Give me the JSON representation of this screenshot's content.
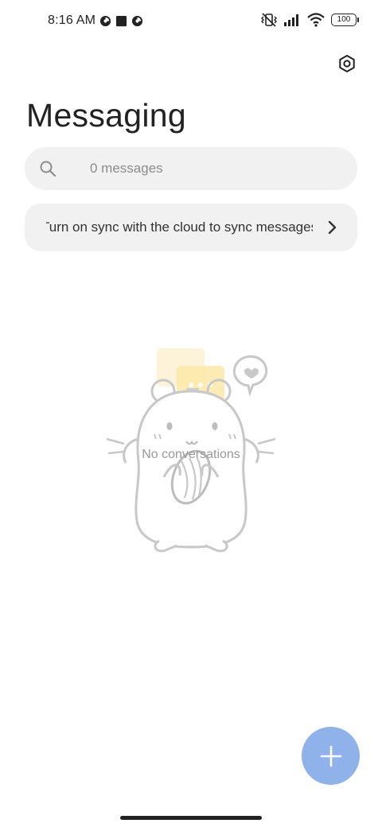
{
  "status_bar": {
    "time": "8:16 AM",
    "battery": "100",
    "left_icons": [
      "data-saver-icon",
      "square-notification-icon",
      "data-saver-icon"
    ],
    "right_icons": [
      "vibrate-off-icon",
      "signal-icon",
      "wifi-icon",
      "battery-icon"
    ]
  },
  "header": {
    "title": "Messaging",
    "settings_icon": "settings-hexagon-icon"
  },
  "search": {
    "placeholder": "0 messages",
    "icon": "search-icon"
  },
  "sync_banner": {
    "text": "Turn on sync with the cloud to sync messages",
    "icon": "chevron-right-icon"
  },
  "empty_state": {
    "message": "No conversations",
    "illustration": "hamster-illustration"
  },
  "fab": {
    "icon": "plus-icon",
    "color": "#8fb2ea"
  }
}
